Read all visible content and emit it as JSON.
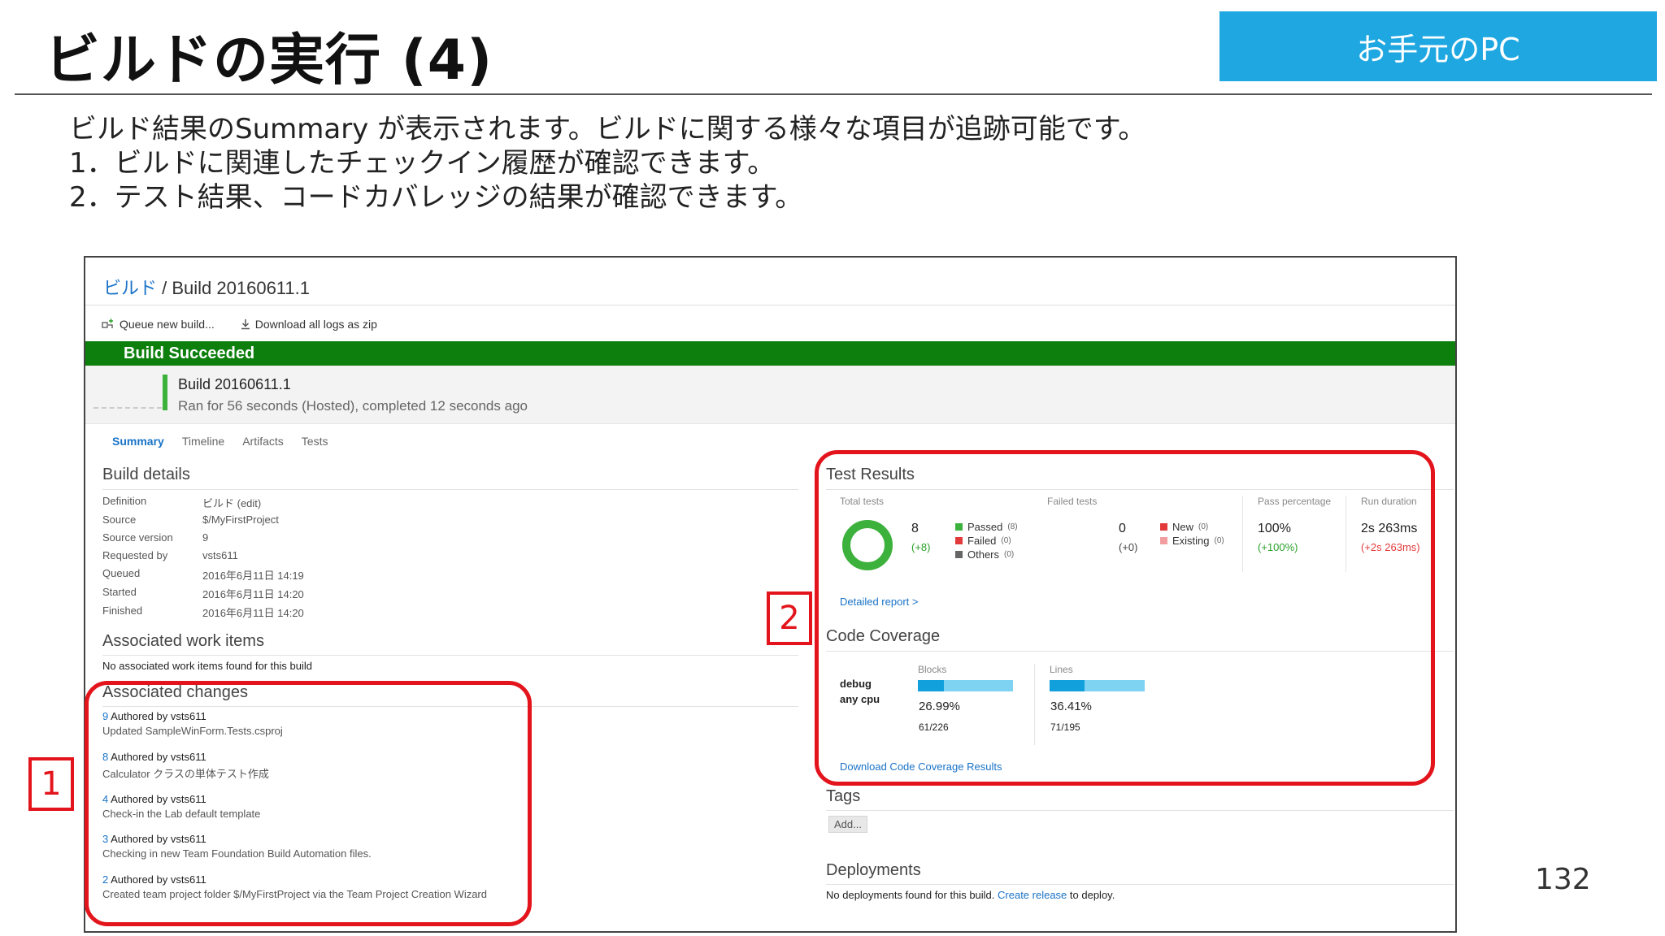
{
  "slide": {
    "title": "ビルドの実行 (4)",
    "badge": "お手元のPC",
    "lines": [
      "ビルド結果のSummary が表示されます。ビルドに関する様々な項目が追跡可能です。",
      "1．ビルドに関連したチェックイン履歴が確認できます。",
      "2．テスト結果、コードカバレッジの結果が確認できます。"
    ],
    "page_number": "132",
    "callouts": [
      "1",
      "2"
    ]
  },
  "build": {
    "breadcrumb_root": "ビルド",
    "breadcrumb_sep": " / ",
    "breadcrumb_current": "Build 20160611.1",
    "toolbar": {
      "queue_label": "Queue new build...",
      "download_label": "Download all logs as zip"
    },
    "status_banner": "Build Succeeded",
    "build_name": "Build 20160611.1",
    "build_sub": "Ran for 56 seconds (Hosted), completed 12 seconds ago",
    "tabs": [
      "Summary",
      "Timeline",
      "Artifacts",
      "Tests"
    ],
    "details": {
      "title": "Build details",
      "rows": [
        {
          "label": "Definition",
          "value": "ビルド (edit)",
          "link": true
        },
        {
          "label": "Source",
          "value": "$/MyFirstProject",
          "link": true
        },
        {
          "label": "Source version",
          "value": "9",
          "link": true
        },
        {
          "label": "Requested by",
          "value": "vsts611",
          "link": false
        },
        {
          "label": "Queued",
          "value": "2016年6月11日 14:19",
          "link": false
        },
        {
          "label": "Started",
          "value": "2016年6月11日 14:20",
          "link": false
        },
        {
          "label": "Finished",
          "value": "2016年6月11日 14:20",
          "link": false
        }
      ]
    },
    "work_items": {
      "title": "Associated work items",
      "empty": "No associated work items found for this build"
    },
    "changes": {
      "title": "Associated changes",
      "items": [
        {
          "id": "9",
          "author": "Authored by vsts611",
          "message": "Updated SampleWinForm.Tests.csproj"
        },
        {
          "id": "8",
          "author": "Authored by vsts611",
          "message": "Calculator クラスの単体テスト作成"
        },
        {
          "id": "4",
          "author": "Authored by vsts611",
          "message": "Check-in the Lab default template"
        },
        {
          "id": "3",
          "author": "Authored by vsts611",
          "message": "Checking in new Team Foundation Build Automation files."
        },
        {
          "id": "2",
          "author": "Authored by vsts611",
          "message": "Created team project folder $/MyFirstProject via the Team Project Creation Wizard"
        }
      ]
    },
    "test_results": {
      "title": "Test Results",
      "total_header": "Total tests",
      "total": "8",
      "total_delta": "(+8)",
      "legend": [
        {
          "label": "Passed",
          "count": "(8)",
          "color": "#3cb13c"
        },
        {
          "label": "Failed",
          "count": "(0)",
          "color": "#e23a3a"
        },
        {
          "label": "Others",
          "count": "(0)",
          "color": "#666666"
        }
      ],
      "passed_fraction": 1.0,
      "failed_header": "Failed tests",
      "failed": "0",
      "failed_delta": "(+0)",
      "failed_legend": [
        {
          "label": "New",
          "count": "(0)",
          "color": "#e23a3a"
        },
        {
          "label": "Existing",
          "count": "(0)",
          "color": "#f29ea0"
        }
      ],
      "pass_header": "Pass percentage",
      "pass_value": "100%",
      "pass_delta": "(+100%)",
      "duration_header": "Run duration",
      "duration_value": "2s 263ms",
      "duration_delta": "(+2s 263ms)",
      "detailed_link": "Detailed report >"
    },
    "coverage": {
      "title": "Code Coverage",
      "config": "debug",
      "platform": "any cpu",
      "blocks_header": "Blocks",
      "blocks_pct": "26.99%",
      "blocks_count": "61/226",
      "blocks_fraction": 0.2699,
      "lines_header": "Lines",
      "lines_pct": "36.41%",
      "lines_count": "71/195",
      "lines_fraction": 0.3641,
      "download_link": "Download Code Coverage Results"
    },
    "tags": {
      "title": "Tags",
      "add_label": "Add..."
    },
    "deployments": {
      "title": "Deployments",
      "text_before": "No deployments found for this build. ",
      "link": "Create release",
      "text_after": " to deploy."
    }
  }
}
